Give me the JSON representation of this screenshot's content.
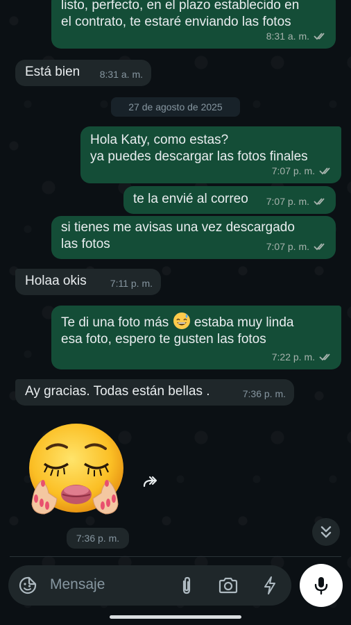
{
  "messages": [
    {
      "id": "m1",
      "direction": "out",
      "text": "listo, perfecto, en el plazo establecido en\nel contrato, te estaré enviando las fotos",
      "time": "8:31 a. m.",
      "status": "read"
    },
    {
      "id": "m2",
      "direction": "in",
      "text": "Está bien",
      "time": "8:31 a. m."
    },
    {
      "id": "m3",
      "direction": "out",
      "text": "Hola Katy, como estas?\nya puedes descargar las fotos finales",
      "time": "7:07 p. m.",
      "status": "read"
    },
    {
      "id": "m4",
      "direction": "out",
      "text": "te la envié al correo",
      "time": "7:07 p. m.",
      "status": "read"
    },
    {
      "id": "m5",
      "direction": "out",
      "text": "si tienes me avisas una vez descargado\nlas fotos",
      "time": "7:07 p. m.",
      "status": "read"
    },
    {
      "id": "m6",
      "direction": "in",
      "text": "Holaa okis",
      "time": "7:11 p. m."
    },
    {
      "id": "m7",
      "direction": "out",
      "text_before": "Te di una foto más ",
      "emoji": "grinning-sweat-emoji",
      "text_after": " estaba muy linda\nesa foto, espero te gusten las fotos",
      "time": "7:22 p. m.",
      "status": "read"
    },
    {
      "id": "m8",
      "direction": "in",
      "text": "Ay gracias. Todas están bellas .",
      "time": "7:36 p. m."
    }
  ],
  "date_separator": "27 de agosto de 2025",
  "sticker": {
    "icon": "kissing-face-sticker",
    "time": "7:36 p. m."
  },
  "composer": {
    "placeholder": "Mensaje"
  },
  "colors": {
    "outgoing": "#144d37",
    "incoming": "#1f272a",
    "background": "#0b1014",
    "ticks": "#a7b3ad"
  }
}
